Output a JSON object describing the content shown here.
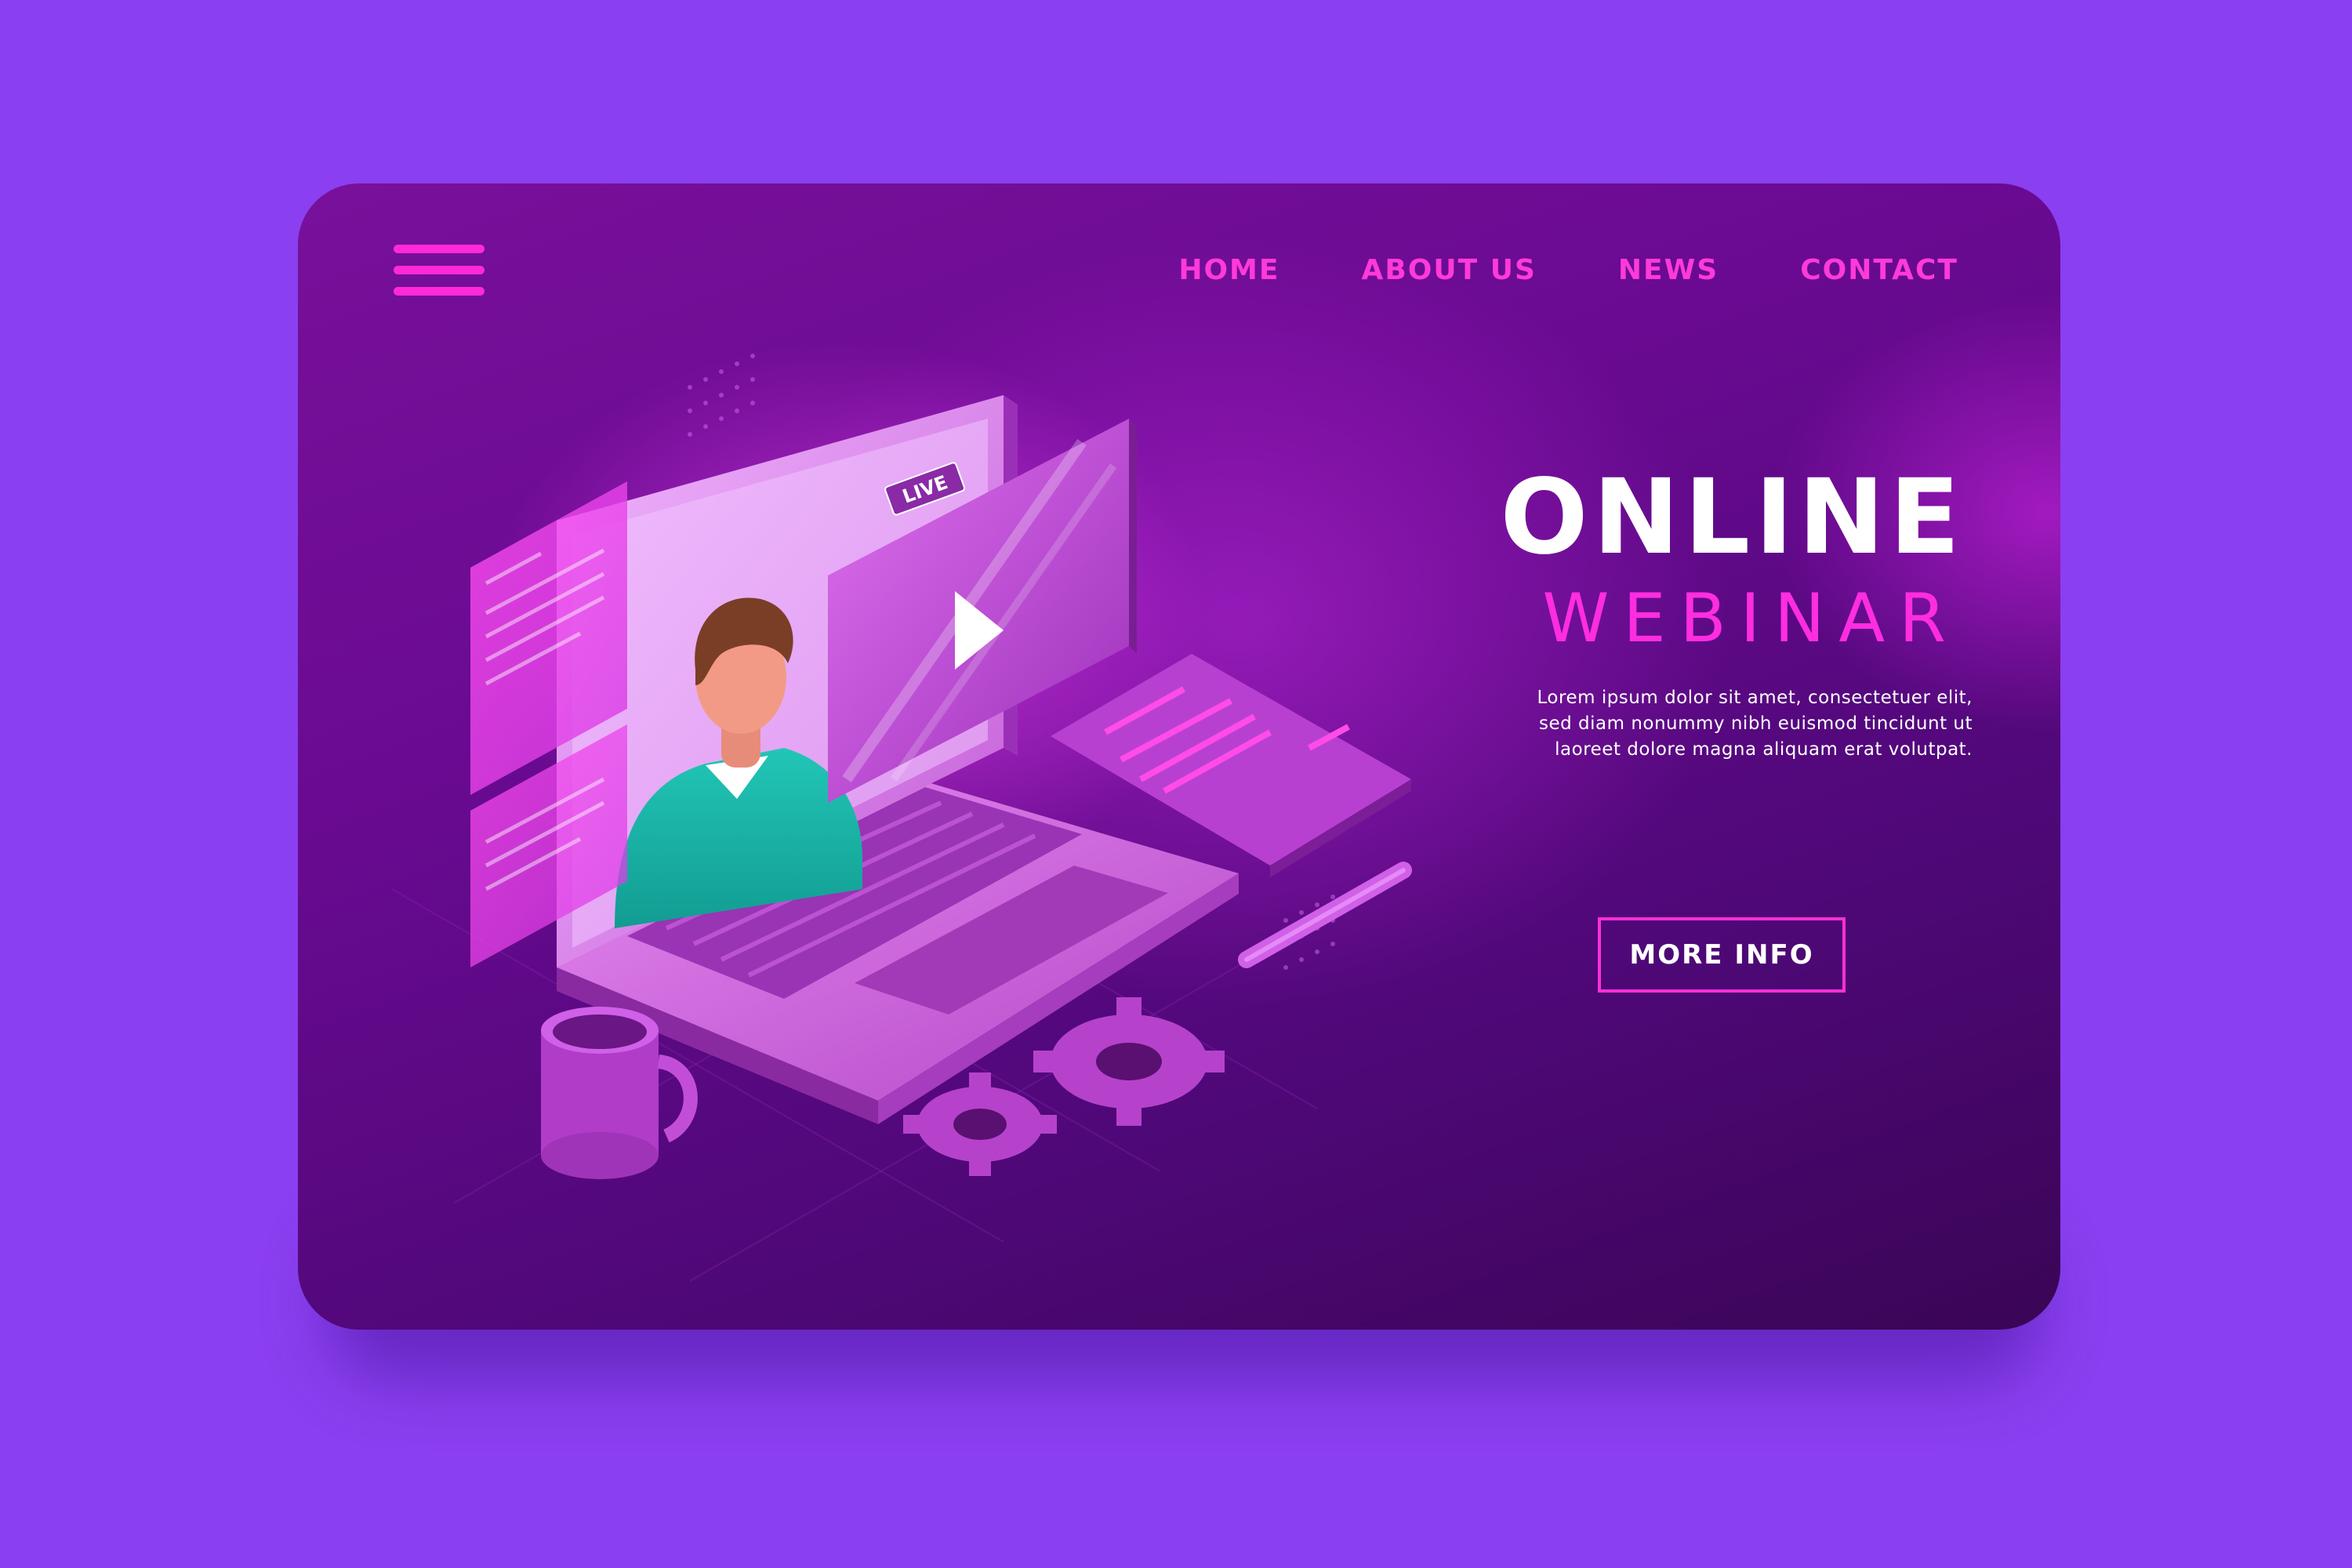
{
  "nav": {
    "menu_icon": "hamburger-menu-icon",
    "items": [
      {
        "label": "HOME"
      },
      {
        "label": "ABOUT US"
      },
      {
        "label": "NEWS"
      },
      {
        "label": "CONTACT"
      }
    ]
  },
  "hero": {
    "title_line1": "ONLINE",
    "title_line2": "WEBINAR",
    "description_lines": [
      "Lorem ipsum dolor sit amet, consectetuer elit,",
      "sed diam nonummy nibh euismod tincidunt ut",
      "laoreet dolore magna aliquam erat volutpat."
    ],
    "cta_label": "MORE INFO"
  },
  "illustration": {
    "live_badge": "LIVE",
    "icons": [
      "laptop-icon",
      "play-icon",
      "gear-icon",
      "mug-icon",
      "pen-icon",
      "document-icon"
    ]
  },
  "colors": {
    "page_background": "#8a3ff0",
    "card_dark": "#3a0556",
    "card_mid": "#6a0a92",
    "accent_pink": "#ff2de0",
    "text_white": "#ffffff"
  }
}
